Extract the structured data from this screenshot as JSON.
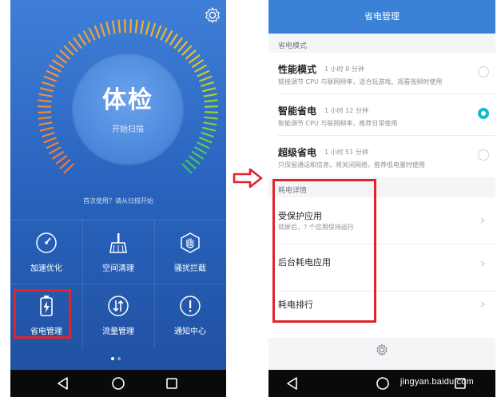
{
  "left_screen": {
    "title": "体检",
    "subtitle": "开始扫描",
    "hint": "首次使用？请从扫描开始",
    "tools": [
      {
        "label": "加速优化",
        "icon": "speedometer-icon"
      },
      {
        "label": "空间清理",
        "icon": "broom-icon"
      },
      {
        "label": "骚扰拦截",
        "icon": "hand-stop-icon"
      },
      {
        "label": "省电管理",
        "icon": "battery-icon"
      },
      {
        "label": "流量管理",
        "icon": "data-traffic-icon"
      },
      {
        "label": "通知中心",
        "icon": "notification-icon"
      }
    ],
    "colors": {
      "bg_top": "#3f7fd8",
      "bg_bottom": "#1f4f9e",
      "highlight": "#e0242b"
    }
  },
  "right_screen": {
    "title": "省电管理",
    "mode_section_label": "省电模式",
    "modes": [
      {
        "name": "性能模式",
        "time": "1 小时 8 分钟",
        "desc": "链接调节 CPU 与联网频率，适合玩游戏、观看视频时使用",
        "selected": false
      },
      {
        "name": "智能省电",
        "time": "1 小时 12 分钟",
        "desc": "智能调节 CPU 与联网频率，推荐日常使用",
        "selected": true
      },
      {
        "name": "超级省电",
        "time": "1 小时 51 分钟",
        "desc": "只保留通话和信息，将关闭网络，推荐低电量时使用",
        "selected": false
      }
    ],
    "detail_section_label": "耗电详情",
    "details": [
      {
        "title": "受保护应用",
        "sub": "锁屏后，? 个应用保持运行"
      },
      {
        "title": "后台耗电应用",
        "sub": ""
      },
      {
        "title": "耗电排行",
        "sub": ""
      }
    ],
    "accent": "#3b82d6",
    "selected_color": "#19b9c9"
  },
  "watermark": "jingyan.baidu.com"
}
